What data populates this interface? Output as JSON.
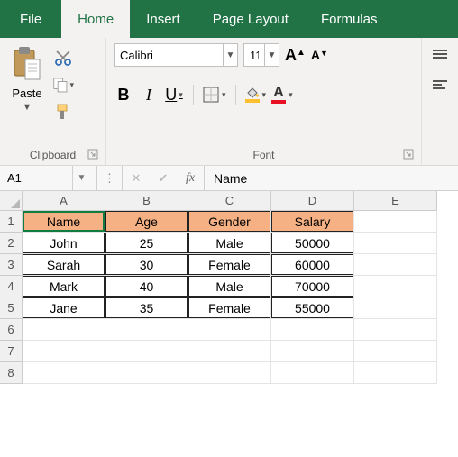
{
  "menu": {
    "file": "File",
    "home": "Home",
    "insert": "Insert",
    "pagelayout": "Page Layout",
    "formulas": "Formulas"
  },
  "ribbon": {
    "clipboard": {
      "paste": "Paste",
      "label": "Clipboard"
    },
    "font": {
      "name": "Calibri",
      "size": "11",
      "bold": "B",
      "italic": "I",
      "underline": "U",
      "increaseA": "A",
      "decreaseA": "A",
      "fillA": "A",
      "colorA": "A",
      "label": "Font"
    }
  },
  "formula_bar": {
    "namebox": "A1",
    "fx": "fx",
    "value": "Name"
  },
  "grid": {
    "cols": [
      "A",
      "B",
      "C",
      "D",
      "E"
    ],
    "rows": [
      "1",
      "2",
      "3",
      "4",
      "5",
      "6",
      "7",
      "8"
    ],
    "header": {
      "c0": "Name",
      "c1": "Age",
      "c2": "Gender",
      "c3": "Salary"
    },
    "data": [
      {
        "c0": "John",
        "c1": "25",
        "c2": "Male",
        "c3": "50000"
      },
      {
        "c0": "Sarah",
        "c1": "30",
        "c2": "Female",
        "c3": "60000"
      },
      {
        "c0": "Mark",
        "c1": "40",
        "c2": "Male",
        "c3": "70000"
      },
      {
        "c0": "Jane",
        "c1": "35",
        "c2": "Female",
        "c3": "55000"
      }
    ]
  }
}
